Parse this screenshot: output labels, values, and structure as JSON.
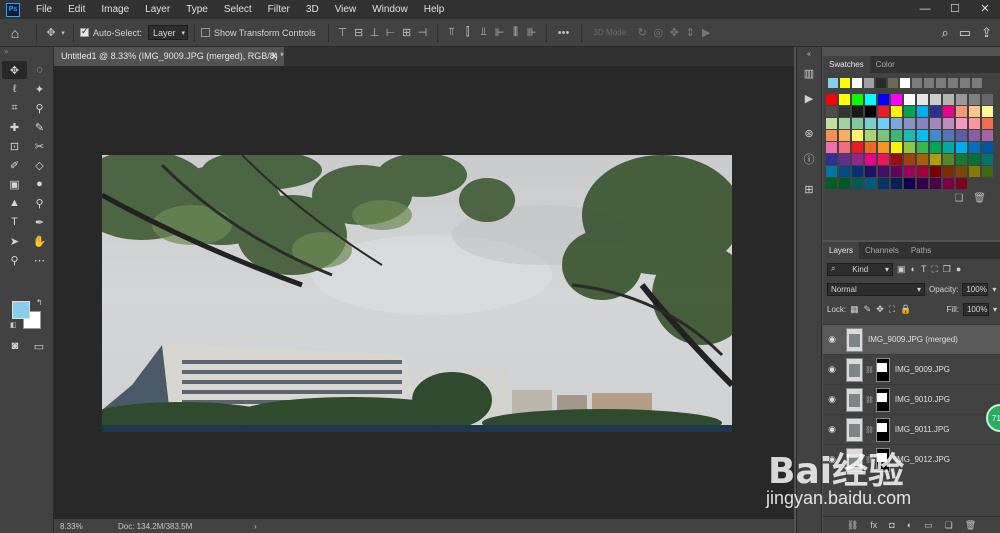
{
  "app": {
    "logo": "Ps"
  },
  "menu": [
    "File",
    "Edit",
    "Image",
    "Layer",
    "Type",
    "Select",
    "Filter",
    "3D",
    "View",
    "Window",
    "Help"
  ],
  "window_controls": [
    "—",
    "☐",
    "✕"
  ],
  "options_bar": {
    "auto_select_label": "Auto-Select:",
    "auto_select_target": "Layer",
    "show_transform_label": "Show Transform Controls",
    "mode_3d_label": "3D Mode:",
    "more": "•••"
  },
  "document": {
    "tab_title": "Untitled1 @ 8.33% (IMG_9009.JPG (merged), RGB/8) *",
    "close": "✕"
  },
  "status": {
    "zoom": "8.33%",
    "doc_size": "Doc: 134.2M/383.5M",
    "arrow": "›"
  },
  "panels": {
    "swatches_tabs": [
      "Swatches",
      "Color"
    ],
    "recent_swatches": [
      "#87ceeb",
      "#ffff00",
      "#ffffff",
      "#a0a0a0",
      "#2b2b2b",
      "#6b6b55",
      "#ffffff",
      "#7c7c7c",
      "#7c7c7c",
      "#7c7c7c",
      "#7c7c7c",
      "#7c7c7c",
      "#7c7c7c"
    ],
    "swatches": [
      "#ff0000",
      "#ffff00",
      "#00ff00",
      "#00ffff",
      "#0000ff",
      "#ff00ff",
      "#ffffff",
      "#e6e6e6",
      "#cccccc",
      "#b3b3b3",
      "#999999",
      "#808080",
      "#666666",
      "#4d4d4d",
      "#333333",
      "#1a1a1a",
      "#000000",
      "#ed1c24",
      "#fff200",
      "#00a651",
      "#00aeef",
      "#2e3192",
      "#ec008c",
      "#f7977a",
      "#fdc68a",
      "#fff79a",
      "#c4df9b",
      "#a2d39c",
      "#82ca9d",
      "#7bcdc8",
      "#6ecff6",
      "#7ea7d8",
      "#8493ca",
      "#8882be",
      "#a187be",
      "#bc8dbf",
      "#f49ac2",
      "#f6989d",
      "#f26c4f",
      "#f68e55",
      "#fbaf5c",
      "#fff467",
      "#acd372",
      "#7cc576",
      "#3bb878",
      "#1abbb4",
      "#00bff3",
      "#438cca",
      "#5574b9",
      "#605ca8",
      "#855fa8",
      "#a763a8",
      "#f06ea9",
      "#f26d7d",
      "#ed1c24",
      "#f26522",
      "#f7941d",
      "#fff200",
      "#8dc63f",
      "#39b54a",
      "#00a651",
      "#00a99d",
      "#00aeef",
      "#0072bc",
      "#0054a6",
      "#2e3192",
      "#662d91",
      "#92278f",
      "#ec008c",
      "#ed145b",
      "#9e0b0f",
      "#a0410d",
      "#a36209",
      "#aba000",
      "#598527",
      "#197b30",
      "#007236",
      "#00746b",
      "#0076a3",
      "#004b80",
      "#003471",
      "#1b1464",
      "#440e62",
      "#630460",
      "#9e005d",
      "#9e0039",
      "#790000",
      "#7b2e00",
      "#7d4900",
      "#827b00",
      "#406618",
      "#005e20",
      "#005826",
      "#005952",
      "#005b7f",
      "#003663",
      "#002157",
      "#0d004c",
      "#32004b",
      "#4b0049",
      "#7b0046",
      "#7a0026"
    ],
    "swatch_footer": [
      "❏",
      "🗑"
    ],
    "layers_tabs": [
      "Layers",
      "Channels",
      "Paths"
    ],
    "kind_label": "Kind",
    "blend_mode": "Normal",
    "opacity_label": "Opacity:",
    "opacity_value": "100%",
    "lock_label": "Lock:",
    "fill_label": "Fill:",
    "fill_value": "100%",
    "layers": [
      {
        "name": "IMG_9009.JPG (merged)",
        "selected": true,
        "mask": false
      },
      {
        "name": "IMG_9009.JPG",
        "selected": false,
        "mask": true
      },
      {
        "name": "IMG_9010.JPG",
        "selected": false,
        "mask": true
      },
      {
        "name": "IMG_9011.JPG",
        "selected": false,
        "mask": true
      },
      {
        "name": "IMG_9012.JPG",
        "selected": false,
        "mask": true
      }
    ],
    "layers_footer": [
      "⛓",
      "fx",
      "◘",
      "◐",
      "▭",
      "❏",
      "🗑"
    ]
  },
  "colors": {
    "foreground": "#87ceeb",
    "background": "#ffffff"
  },
  "badge": "71",
  "watermark": {
    "brand": "Bai经验",
    "url": "jingyan.baidu.com"
  }
}
